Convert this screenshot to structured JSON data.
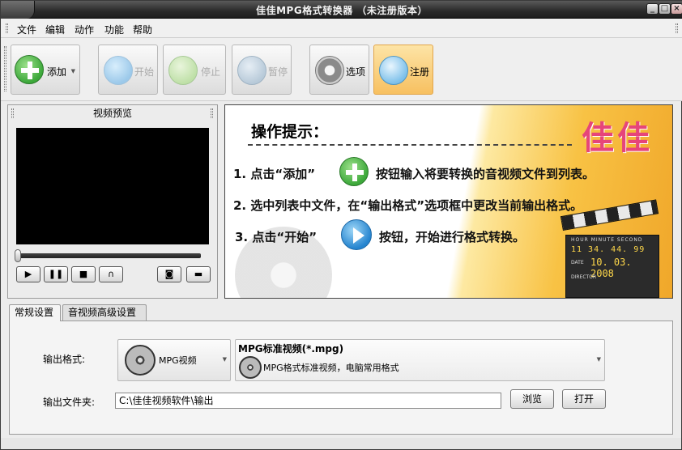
{
  "window": {
    "title": "佳佳MPG格式转换器  （未注册版本）"
  },
  "menu": [
    "文件",
    "编辑",
    "动作",
    "功能",
    "帮助"
  ],
  "toolbar": {
    "add": "添加",
    "start": "开始",
    "stop": "停止",
    "pause": "暂停",
    "options": "选项",
    "register": "注册"
  },
  "preview": {
    "title": "视频预览"
  },
  "tips": {
    "title": "操作提示：",
    "brand": "佳佳",
    "line1_a": "1. 点击“添加”",
    "line1_b": "按钮输入将要转换的音视频文件到列表。",
    "line2": "2. 选中列表中文件，在“输出格式”选项框中更改当前输出格式。",
    "line3_a": "3. 点击“开始”",
    "line3_b": "按钮，开始进行格式转换。",
    "clap_row1_label": "HOUR  MINUTE  SECOND",
    "clap_time": "11  34. 44. 99",
    "clap_date_label": "DATE",
    "clap_date": "10. 03. 2008",
    "clap_director": "DIRECTOR"
  },
  "tabs": [
    "常规设置",
    "音视频高级设置"
  ],
  "settings": {
    "format_label": "输出格式:",
    "format_category": "MPG视频",
    "format_name": "MPG标准视频(*.mpg)",
    "format_desc": "MPG格式标准视频，电脑常用格式",
    "folder_label": "输出文件夹:",
    "folder_value": "C:\\佳佳视频软件\\输出",
    "browse": "浏览",
    "open": "打开"
  },
  "colors": {
    "accent_orange": "#f8c244",
    "brand_pink": "#e6457a",
    "title_bg": "#2a2a2a"
  }
}
